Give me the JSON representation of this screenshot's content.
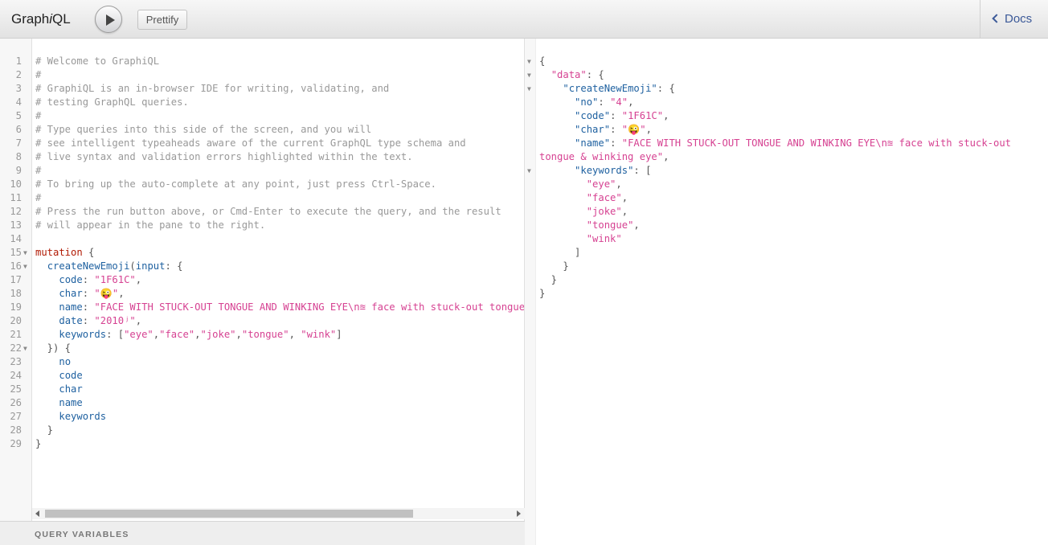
{
  "toolbar": {
    "title_prefix": "Graph",
    "title_italic": "i",
    "title_suffix": "QL",
    "prettify_label": "Prettify",
    "docs_label": "Docs"
  },
  "editor": {
    "lines": [
      [
        [
          "c-comment",
          "# Welcome to GraphiQL"
        ]
      ],
      [
        [
          "c-comment",
          "#"
        ]
      ],
      [
        [
          "c-comment",
          "# GraphiQL is an in-browser IDE for writing, validating, and"
        ]
      ],
      [
        [
          "c-comment",
          "# testing GraphQL queries."
        ]
      ],
      [
        [
          "c-comment",
          "#"
        ]
      ],
      [
        [
          "c-comment",
          "# Type queries into this side of the screen, and you will"
        ]
      ],
      [
        [
          "c-comment",
          "# see intelligent typeaheads aware of the current GraphQL type schema and"
        ]
      ],
      [
        [
          "c-comment",
          "# live syntax and validation errors highlighted within the text."
        ]
      ],
      [
        [
          "c-comment",
          "#"
        ]
      ],
      [
        [
          "c-comment",
          "# To bring up the auto-complete at any point, just press Ctrl-Space."
        ]
      ],
      [
        [
          "c-comment",
          "#"
        ]
      ],
      [
        [
          "c-comment",
          "# Press the run button above, or Cmd-Enter to execute the query, and the result"
        ]
      ],
      [
        [
          "c-comment",
          "# will appear in the pane to the right."
        ]
      ],
      [],
      [
        [
          "c-kw",
          "mutation"
        ],
        [
          "c-punc",
          " {"
        ]
      ],
      [
        [
          "",
          "  "
        ],
        [
          "c-def",
          "createNewEmoji"
        ],
        [
          "c-punc",
          "("
        ],
        [
          "c-attr",
          "input"
        ],
        [
          "c-punc",
          ": {"
        ]
      ],
      [
        [
          "",
          "    "
        ],
        [
          "c-attr",
          "code"
        ],
        [
          "c-punc",
          ": "
        ],
        [
          "c-str",
          "\"1F61C\""
        ],
        [
          "c-punc",
          ","
        ]
      ],
      [
        [
          "",
          "    "
        ],
        [
          "c-attr",
          "char"
        ],
        [
          "c-punc",
          ": "
        ],
        [
          "c-str",
          "\"😜\""
        ],
        [
          "c-punc",
          ","
        ]
      ],
      [
        [
          "",
          "    "
        ],
        [
          "c-attr",
          "name"
        ],
        [
          "c-punc",
          ": "
        ],
        [
          "c-str",
          "\"FACE WITH STUCK-OUT TONGUE AND WINKING EYE\\n≊ face with stuck-out tongue & winking eye\""
        ],
        [
          "c-punc",
          ","
        ]
      ],
      [
        [
          "",
          "    "
        ],
        [
          "c-attr",
          "date"
        ],
        [
          "c-punc",
          ": "
        ],
        [
          "c-str",
          "\"2010ʲ\""
        ],
        [
          "c-punc",
          ","
        ]
      ],
      [
        [
          "",
          "    "
        ],
        [
          "c-attr",
          "keywords"
        ],
        [
          "c-punc",
          ": ["
        ],
        [
          "c-str",
          "\"eye\""
        ],
        [
          "c-punc",
          ","
        ],
        [
          "c-str",
          "\"face\""
        ],
        [
          "c-punc",
          ","
        ],
        [
          "c-str",
          "\"joke\""
        ],
        [
          "c-punc",
          ","
        ],
        [
          "c-str",
          "\"tongue\""
        ],
        [
          "c-punc",
          ", "
        ],
        [
          "c-str",
          "\"wink\""
        ],
        [
          "c-punc",
          "]"
        ]
      ],
      [
        [
          "c-punc",
          "  }) {"
        ]
      ],
      [
        [
          "",
          "    "
        ],
        [
          "c-prop",
          "no"
        ]
      ],
      [
        [
          "",
          "    "
        ],
        [
          "c-prop",
          "code"
        ]
      ],
      [
        [
          "",
          "    "
        ],
        [
          "c-prop",
          "char"
        ]
      ],
      [
        [
          "",
          "    "
        ],
        [
          "c-prop",
          "name"
        ]
      ],
      [
        [
          "",
          "    "
        ],
        [
          "c-prop",
          "keywords"
        ]
      ],
      [
        [
          "c-punc",
          "  }"
        ]
      ],
      [
        [
          "c-punc",
          "}"
        ]
      ]
    ],
    "fold_lines": [
      15,
      16,
      22
    ]
  },
  "query_variables_label": "QUERY VARIABLES",
  "result": {
    "lines": [
      [
        [
          "c-punc",
          "{"
        ]
      ],
      [
        [
          "",
          "  "
        ],
        [
          "c-str",
          "\"data\""
        ],
        [
          "c-punc",
          ": {"
        ]
      ],
      [
        [
          "",
          "    "
        ],
        [
          "c-def",
          "\"createNewEmoji\""
        ],
        [
          "c-punc",
          ": {"
        ]
      ],
      [
        [
          "",
          "      "
        ],
        [
          "c-def",
          "\"no\""
        ],
        [
          "c-punc",
          ": "
        ],
        [
          "c-str",
          "\"4\""
        ],
        [
          "c-punc",
          ","
        ]
      ],
      [
        [
          "",
          "      "
        ],
        [
          "c-def",
          "\"code\""
        ],
        [
          "c-punc",
          ": "
        ],
        [
          "c-str",
          "\"1F61C\""
        ],
        [
          "c-punc",
          ","
        ]
      ],
      [
        [
          "",
          "      "
        ],
        [
          "c-def",
          "\"char\""
        ],
        [
          "c-punc",
          ": "
        ],
        [
          "c-str",
          "\"😜\""
        ],
        [
          "c-punc",
          ","
        ]
      ],
      [
        [
          "",
          "      "
        ],
        [
          "c-def",
          "\"name\""
        ],
        [
          "c-punc",
          ": "
        ],
        [
          "c-str",
          "\"FACE WITH STUCK-OUT TONGUE AND WINKING EYE\\n≊ face with stuck-out"
        ]
      ],
      [
        [
          "c-str",
          "tongue & winking eye\""
        ],
        [
          "c-punc",
          ","
        ]
      ],
      [
        [
          "",
          "      "
        ],
        [
          "c-def",
          "\"keywords\""
        ],
        [
          "c-punc",
          ": ["
        ]
      ],
      [
        [
          "",
          "        "
        ],
        [
          "c-str",
          "\"eye\""
        ],
        [
          "c-punc",
          ","
        ]
      ],
      [
        [
          "",
          "        "
        ],
        [
          "c-str",
          "\"face\""
        ],
        [
          "c-punc",
          ","
        ]
      ],
      [
        [
          "",
          "        "
        ],
        [
          "c-str",
          "\"joke\""
        ],
        [
          "c-punc",
          ","
        ]
      ],
      [
        [
          "",
          "        "
        ],
        [
          "c-str",
          "\"tongue\""
        ],
        [
          "c-punc",
          ","
        ]
      ],
      [
        [
          "",
          "        "
        ],
        [
          "c-str",
          "\"wink\""
        ]
      ],
      [
        [
          "c-punc",
          "      ]"
        ]
      ],
      [
        [
          "c-punc",
          "    }"
        ]
      ],
      [
        [
          "c-punc",
          "  }"
        ]
      ],
      [
        [
          "c-punc",
          "}"
        ]
      ]
    ],
    "fold_lines": [
      1,
      2,
      3,
      9
    ]
  }
}
